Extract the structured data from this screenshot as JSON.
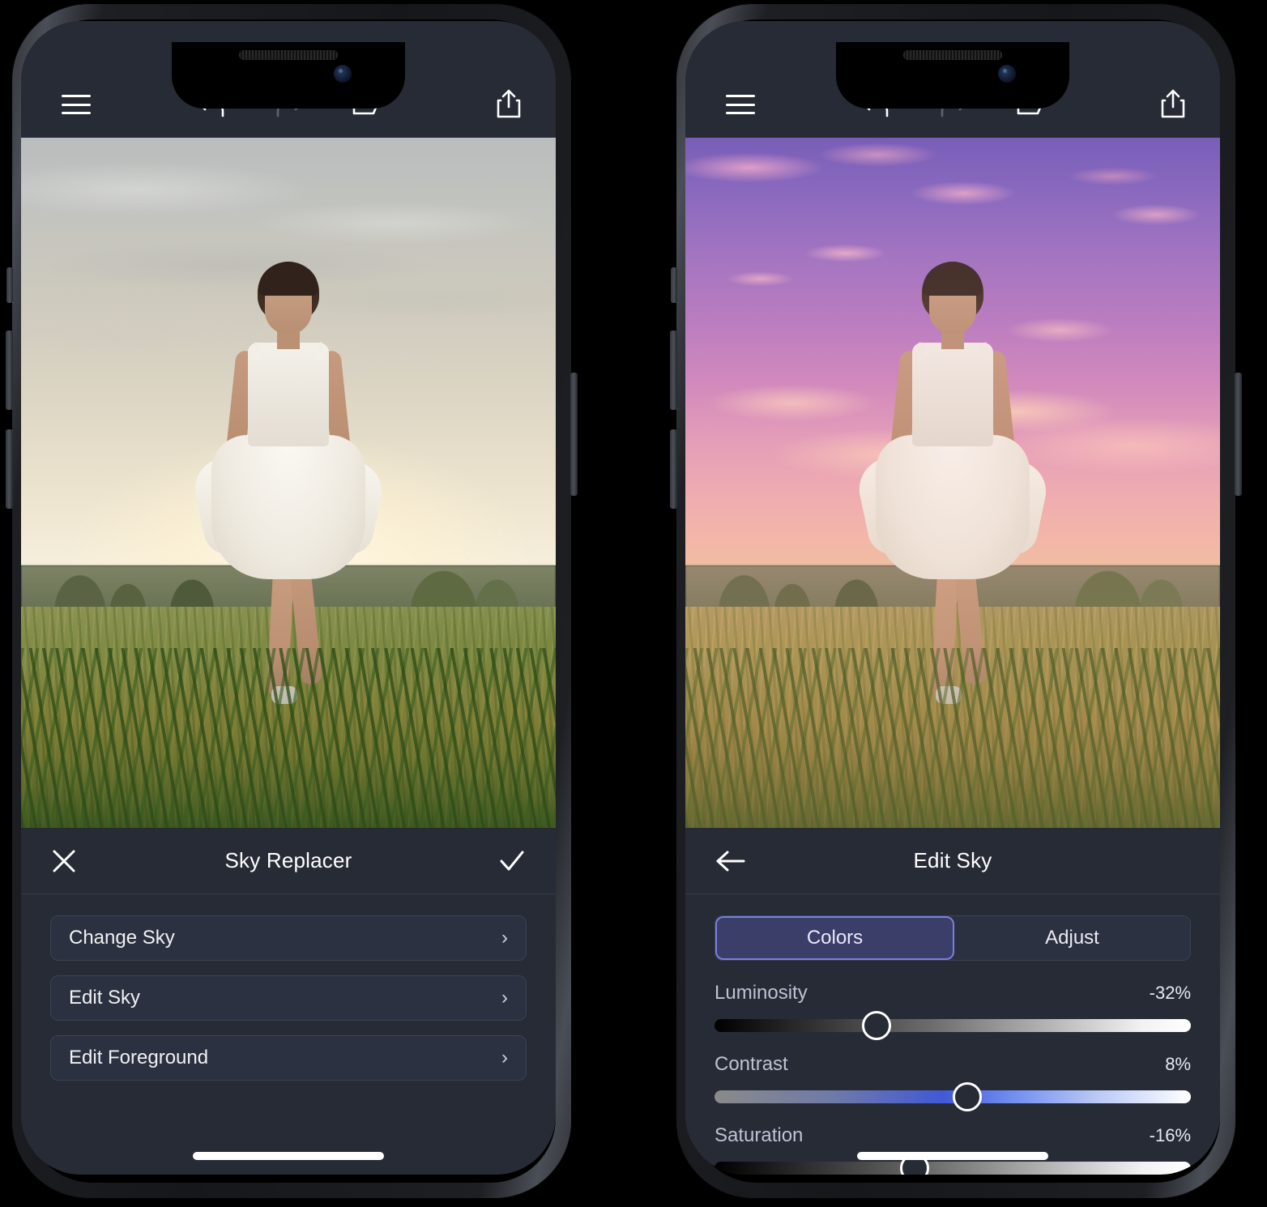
{
  "app": {
    "toolbar": {
      "menu_icon": "hamburger-menu-icon",
      "undo_icon": "undo-icon",
      "redo_icon": "redo-icon",
      "open_icon": "open-folder-icon",
      "share_icon": "share-export-icon"
    }
  },
  "left_phone": {
    "panel": {
      "title": "Sky Replacer",
      "close_icon": "close-x-icon",
      "confirm_icon": "checkmark-icon",
      "rows": [
        {
          "label": "Change Sky",
          "chevron": "›"
        },
        {
          "label": "Edit Sky",
          "chevron": "›"
        },
        {
          "label": "Edit Foreground",
          "chevron": "›"
        }
      ]
    }
  },
  "right_phone": {
    "panel": {
      "title": "Edit Sky",
      "back_icon": "arrow-left-icon",
      "tabs": [
        {
          "label": "Colors",
          "active": true
        },
        {
          "label": "Adjust",
          "active": false
        }
      ],
      "sliders": [
        {
          "label": "Luminosity",
          "value": "-32%",
          "position_pct": 34
        },
        {
          "label": "Contrast",
          "value": "8%",
          "position_pct": 53
        },
        {
          "label": "Saturation",
          "value": "-16%",
          "position_pct": 42
        }
      ]
    }
  },
  "colors": {
    "panel_bg": "#262b36",
    "row_bg": "#2b3140",
    "row_border": "#3b4251",
    "tab_active_bg": "#3b3e68",
    "tab_active_border": "#7b7ee0",
    "text_primary": "#ffffff",
    "text_secondary": "#bfc2d2",
    "contrast_accent": "#4159d6",
    "page_bg": "#000000"
  }
}
